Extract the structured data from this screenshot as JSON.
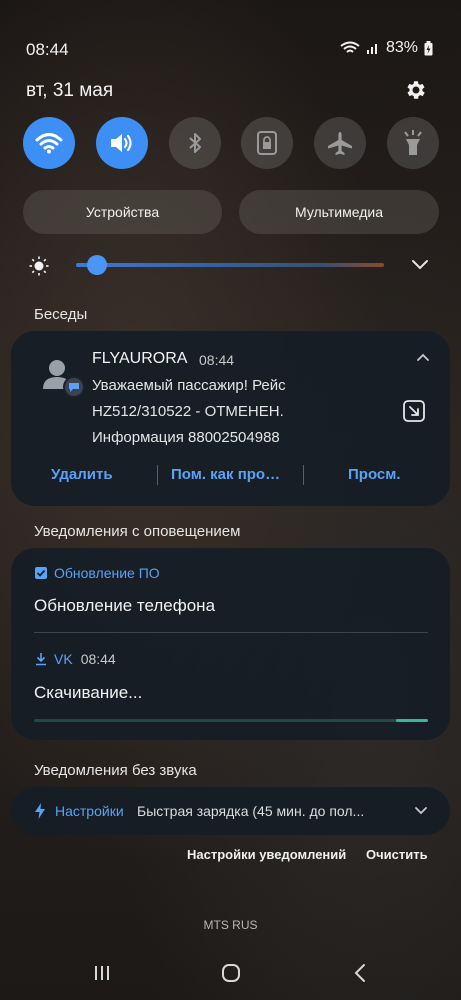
{
  "status": {
    "time": "08:44",
    "battery": "83%"
  },
  "date": "вт, 31 мая",
  "quick_settings": [
    {
      "name": "wifi",
      "on": true
    },
    {
      "name": "sound",
      "on": true
    },
    {
      "name": "bluetooth",
      "on": false
    },
    {
      "name": "rotation-lock",
      "on": false
    },
    {
      "name": "airplane",
      "on": false
    },
    {
      "name": "flashlight",
      "on": false
    }
  ],
  "pills": {
    "devices": "Устройства",
    "media": "Мультимедиа"
  },
  "brightness": {
    "level": 0.05
  },
  "sections": {
    "conversations": "Беседы",
    "alerting": "Уведомления с оповещением",
    "silent": "Уведомления без звука"
  },
  "conversation": {
    "sender": "FLYAURORA",
    "time": "08:44",
    "lines": [
      "Уважаемый пассажир! Рейс",
      "HZ512/310522 - ОТМЕНЕН.",
      "Информация 88002504988"
    ],
    "actions": {
      "delete": "Удалить",
      "mark": "Пом. как про…",
      "view": "Просм."
    }
  },
  "alerting": {
    "update_app": "Обновление ПО",
    "update_title": "Обновление телефона",
    "vk_app": "VK",
    "vk_time": "08:44",
    "vk_title": "Скачивание...",
    "vk_progress": 0.92
  },
  "silent": {
    "app": "Настройки",
    "text": "Быстрая зарядка (45 мин. до пол..."
  },
  "footer": {
    "settings": "Настройки уведомлений",
    "clear": "Очистить",
    "carrier": "MTS RUS"
  },
  "colors": {
    "accent": "#3d8ef5",
    "link": "#5aa2f5",
    "progress": "#2fb8a3"
  }
}
